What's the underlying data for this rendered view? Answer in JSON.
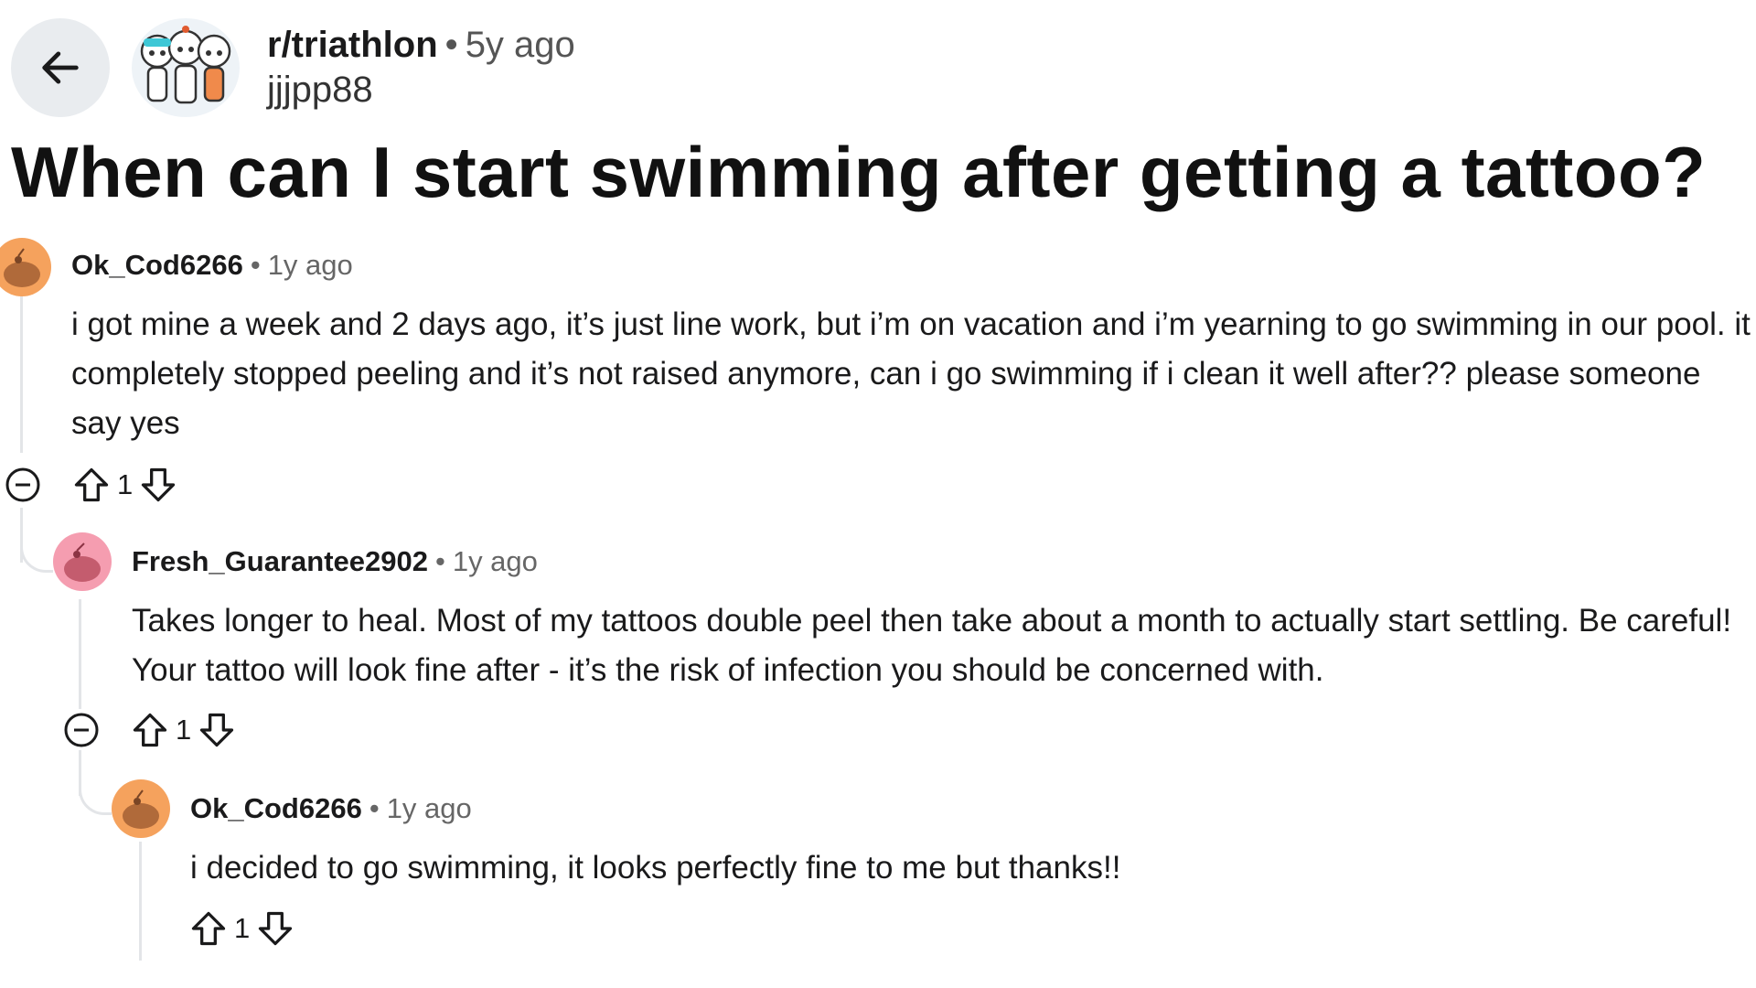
{
  "post": {
    "subreddit": "r/triathlon",
    "age": "5y ago",
    "author": "jjjpp88",
    "title": "When can I start swimming after getting a tattoo?"
  },
  "comments": [
    {
      "user": "Ok_Cod6266",
      "time": "1y ago",
      "body": "i got mine a week and 2 days ago, it’s just line work, but i’m on vacation and i’m yearning to go swimming in our pool. it completely stopped peeling and it’s not raised anymore, can i go swimming if i clean it well after?? please someone say yes",
      "score": "1"
    },
    {
      "user": "Fresh_Guarantee2902",
      "time": "1y ago",
      "body": "Takes longer to heal. Most of my tattoos double peel then take about a month to actually start settling. Be careful! Your tattoo will look fine after - it’s the risk of infection you should be concerned with.",
      "score": "1"
    },
    {
      "user": "Ok_Cod6266",
      "time": "1y ago",
      "body": "i decided to go swimming, it looks perfectly fine to me but thanks!!",
      "score": "1"
    }
  ],
  "colors": {
    "avatar_orange": "#f5a25d",
    "avatar_pink": "#f59db0",
    "back_button_bg": "#e9ecef"
  }
}
